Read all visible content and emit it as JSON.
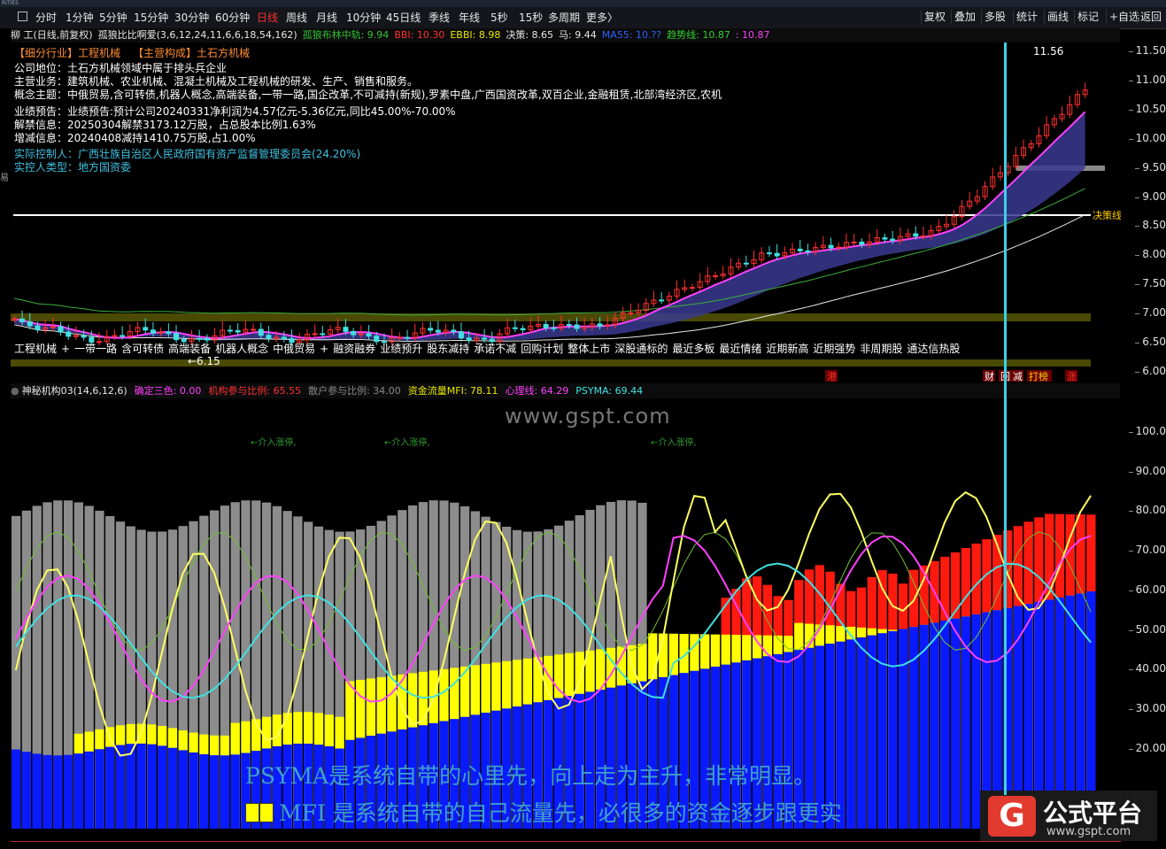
{
  "titlebar": {
    "text": "RITIES"
  },
  "toolbar": {
    "periods": [
      "分时",
      "1分钟",
      "5分钟",
      "15分钟",
      "30分钟",
      "60分钟",
      "日线",
      "周线",
      "月线",
      "10分钟",
      "45日线",
      "季线",
      "年线",
      "5秒",
      "15秒",
      "多周期",
      "更多〉"
    ],
    "active_period": "日线",
    "right_buttons": [
      "复权",
      "叠加",
      "多股",
      "统计",
      "画线",
      "标记",
      "+自选",
      "返回"
    ]
  },
  "header1": {
    "stock": "柳 工(日线,前复权)",
    "indicator": "孤狼比比啊爱(3,6,12,24,11,6,6,18,54,162)",
    "items": [
      {
        "label": "孤狼布林中轨: 9.94",
        "color": "#30c030"
      },
      {
        "label": "BBI: 10.30",
        "color": "#ff3030"
      },
      {
        "label": "EBBI: 8.98",
        "color": "#e6e600"
      },
      {
        "label": "决策: 8.65",
        "color": "#e6e6e6"
      },
      {
        "label": "马: 9.44",
        "color": "#e6e6e6"
      },
      {
        "label": "MA55: 10.??",
        "color": "#3060ff"
      },
      {
        "label": "趋势线: 10.87",
        "color": "#30d030"
      },
      {
        "label": ": 10.87",
        "color": "#ff40ff"
      }
    ]
  },
  "info": {
    "tags": [
      {
        "text": "【细分行业】工程机械",
        "color": "#ff8a30"
      },
      {
        "text": "【主营构成】土石方机械",
        "color": "#ff8a30"
      }
    ],
    "lines": [
      {
        "label": "公司地位：",
        "text": "土石方机械领域中属于排头兵企业",
        "color": "#ffffff"
      },
      {
        "label": "主营业务：",
        "text": "建筑机械、农业机械、混凝土机械及工程机械的研发、生产、销售和服务。",
        "color": "#ffffff"
      },
      {
        "label": "概念主题：",
        "text": "中俄贸易,含可转债,机器人概念,高端装备,一带一路,国企改革,不可减持(新规),罗素中盘,广西国资改革,双百企业,金融租赁,北部湾经济区,农机",
        "color": "#ffffff"
      },
      {
        "label": "业绩预告：",
        "text": "业绩预告:预计公司20240331净利润为4.57亿元-5.36亿元,同比45.00%-70.00%",
        "color": "#ffffff"
      },
      {
        "label": "解禁信息：",
        "text": "20250304解禁3173.12万股，占总股本比例1.63%",
        "color": "#ffffff"
      },
      {
        "label": "增减信息：",
        "text": "20240408减持1410.75万股,占1.00%",
        "color": "#ffffff"
      },
      {
        "label": "实际控制人：",
        "text": "广西壮族自治区人民政府国有资产监督管理委员会(24.20%)",
        "color": "#40c0e0"
      },
      {
        "label": "实控人类型：",
        "text": "地方国资委",
        "color": "#40c0e0"
      }
    ]
  },
  "price_axis": [
    "11.50",
    "11.00",
    "10.50",
    "10.00",
    "9.50",
    "9.00",
    "8.50",
    "8.00",
    "7.50",
    "7.00",
    "6.50",
    "6.00"
  ],
  "price_labels": {
    "high": "11.56",
    "low": "6.15",
    "decision": "决策线"
  },
  "concept_strip": [
    "工程机械",
    "+",
    "一带一路",
    "含可转债",
    "高端装备",
    "机器人概念",
    "中俄贸易",
    "+",
    "融资融券",
    "业绩预升",
    "股东减持",
    "承诺不减",
    "回购计划",
    "整体上市",
    "深股通标的",
    "最近多板",
    "最近情绪",
    "近期新高",
    "近期强势",
    "非周期股",
    "通达信热股"
  ],
  "event_badges": [
    {
      "text": "港",
      "color": "#ff3030"
    },
    {
      "text": "财",
      "color": "#ffffff"
    },
    {
      "text": "回",
      "color": "#ffffff"
    },
    {
      "text": "减",
      "color": "#ffffff"
    },
    {
      "text": "打榜",
      "color": "#ffcc00"
    },
    {
      "text": "涨",
      "color": "#ff3030"
    }
  ],
  "header2": {
    "indicator": "神秘机构03(14,6,12,6)",
    "items": [
      {
        "label": "确定三色: 0.00",
        "color": "#ff40ff"
      },
      {
        "label": "机构参与比例: 65.55",
        "color": "#ff3030"
      },
      {
        "label": "散户参与比例: 34.00",
        "color": "#888888"
      },
      {
        "label": "资金流量MFI: 78.11",
        "color": "#e6e600"
      },
      {
        "label": "心理线: 64.29",
        "color": "#ff40ff"
      },
      {
        "label": "PSYMA: 69.44",
        "color": "#40e0e0"
      }
    ]
  },
  "osc_axis": [
    "100.0",
    "90.00",
    "80.00",
    "70.00",
    "60.00",
    "50.00",
    "40.00",
    "30.00",
    "20.00"
  ],
  "annotations": [
    "←介入涨停,",
    "←介入涨停,",
    "←介入涨停,"
  ],
  "watermark": "www.gspt.com",
  "notes": [
    "PSYMA是系统自带的心里先，向上走为主升，非常明显。",
    "MFI  是系统自带的自己流量先，必很多的资金逐步跟更实"
  ],
  "logo": {
    "title": "公式平台",
    "url": "www.gspt.com"
  },
  "colors": {
    "up": "#ff3030",
    "down": "#40e0e0",
    "blue": "#0a1aff",
    "yellow": "#ffff00",
    "red": "#ff1a10",
    "gray": "#8c8c8c"
  }
}
